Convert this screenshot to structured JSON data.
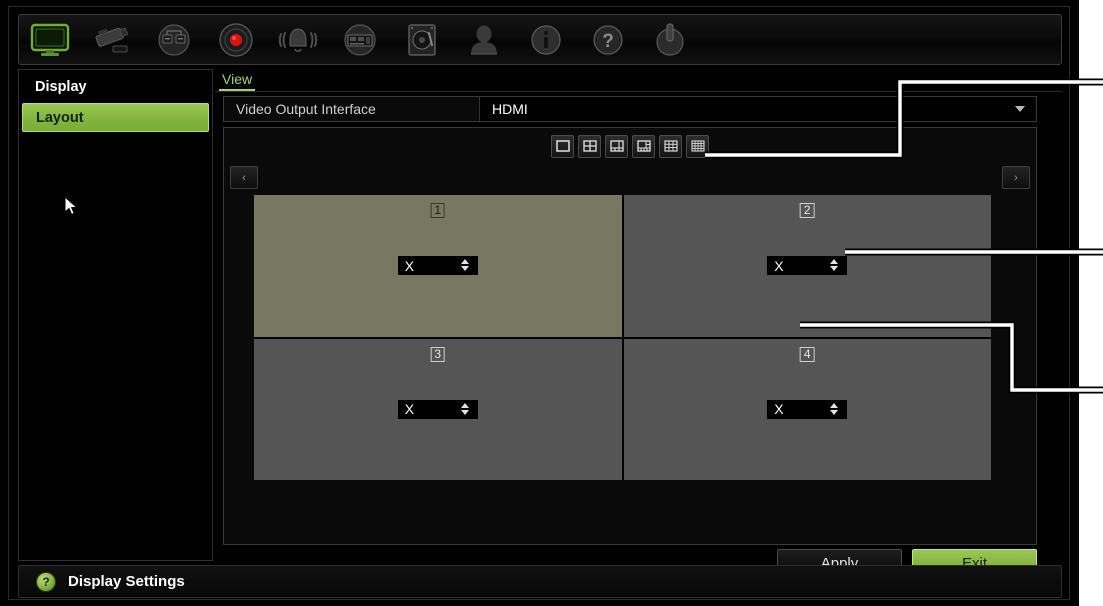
{
  "window": {
    "title": "Display Settings"
  },
  "toolbar": {
    "items": [
      {
        "name": "monitor-icon",
        "label": "Display",
        "active": true
      },
      {
        "name": "camera-icon",
        "label": "Camera",
        "active": false
      },
      {
        "name": "network-icon",
        "label": "Network",
        "active": false
      },
      {
        "name": "record-icon",
        "label": "Record",
        "active": false
      },
      {
        "name": "alarm-icon",
        "label": "Alarm",
        "active": false
      },
      {
        "name": "playback-icon",
        "label": "Playback",
        "active": false
      },
      {
        "name": "hdd-icon",
        "label": "HDD",
        "active": false
      },
      {
        "name": "user-icon",
        "label": "User",
        "active": false
      },
      {
        "name": "info-icon",
        "label": "Information",
        "active": false
      },
      {
        "name": "help-icon",
        "label": "Help",
        "active": false
      },
      {
        "name": "power-icon",
        "label": "Shutdown",
        "active": false
      }
    ]
  },
  "sidebar": {
    "items": [
      {
        "label": "Display",
        "selected": false
      },
      {
        "label": "Layout",
        "selected": true
      }
    ]
  },
  "content": {
    "tab": {
      "label": "View"
    },
    "video_output": {
      "label": "Video Output Interface",
      "value": "HDMI",
      "chevron": "chevron-down-icon"
    },
    "layout_modes": [
      {
        "name": "layout-1x1",
        "label": "1 x 1"
      },
      {
        "name": "layout-2x2",
        "label": "2 x 2"
      },
      {
        "name": "layout-1plus5",
        "label": "1 + 5"
      },
      {
        "name": "layout-1plus7",
        "label": "1 + 7"
      },
      {
        "name": "layout-3x3",
        "label": "3 x 3"
      },
      {
        "name": "layout-4x4",
        "label": "4 x 4"
      }
    ],
    "nav": {
      "prev": "‹",
      "next": "›"
    },
    "tiles": [
      {
        "number": "1",
        "value": "X",
        "selected": true
      },
      {
        "number": "2",
        "value": "X",
        "selected": false
      },
      {
        "number": "3",
        "value": "X",
        "selected": false
      },
      {
        "number": "4",
        "value": "X",
        "selected": false
      }
    ],
    "buttons": {
      "apply": "Apply",
      "exit": "Exit"
    }
  },
  "statusbar": {
    "icon": "help-circle-icon",
    "icon_glyph": "?",
    "text": "Display Settings"
  },
  "colors": {
    "accent_green": "#84b63f",
    "tab_green": "#a9d45a",
    "tile_selected": "#77785f",
    "tile_normal": "#555555",
    "window_bg": "#000000"
  },
  "callouts": [
    {
      "name": "callout-layout-modes",
      "target": "layout mode buttons"
    },
    {
      "name": "callout-camera-dropdown",
      "target": "camera select dropdown"
    },
    {
      "name": "callout-tile-number",
      "target": "tile number label"
    }
  ]
}
